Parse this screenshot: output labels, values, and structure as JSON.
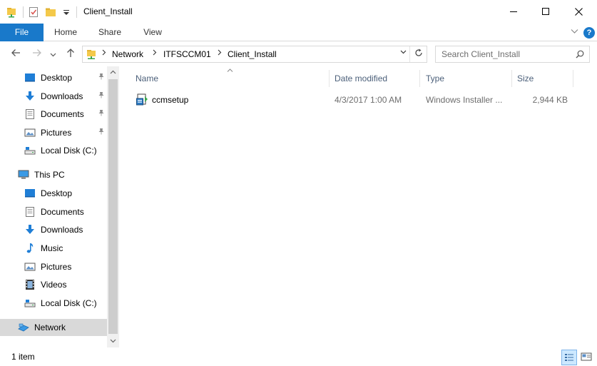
{
  "window": {
    "title": "Client_Install",
    "controls": {
      "minimize_icon": "minimize-icon",
      "maximize_icon": "maximize-icon",
      "close_icon": "close-icon"
    }
  },
  "quick_access_toolbar": {
    "icons": [
      "properties-icon",
      "new-folder-icon",
      "customize-dropdown-icon"
    ]
  },
  "ribbon": {
    "tabs": [
      {
        "label": "File",
        "active": true
      },
      {
        "label": "Home"
      },
      {
        "label": "Share"
      },
      {
        "label": "View"
      }
    ],
    "help_label": "?"
  },
  "address_bar": {
    "breadcrumbs": [
      "Network",
      "ITFSCCM01",
      "Client_Install"
    ]
  },
  "search": {
    "placeholder": "Search Client_Install"
  },
  "nav_pane": {
    "quick_access": [
      {
        "label": "Desktop",
        "icon": "desktop-icon",
        "pinned": true
      },
      {
        "label": "Downloads",
        "icon": "downloads-icon",
        "pinned": true
      },
      {
        "label": "Documents",
        "icon": "documents-icon",
        "pinned": true
      },
      {
        "label": "Pictures",
        "icon": "pictures-icon",
        "pinned": true
      },
      {
        "label": "Local Disk (C:)",
        "icon": "drive-icon",
        "pinned": false
      }
    ],
    "this_pc": {
      "label": "This PC",
      "items": [
        {
          "label": "Desktop",
          "icon": "desktop-icon"
        },
        {
          "label": "Documents",
          "icon": "documents-icon"
        },
        {
          "label": "Downloads",
          "icon": "downloads-icon"
        },
        {
          "label": "Music",
          "icon": "music-icon"
        },
        {
          "label": "Pictures",
          "icon": "pictures-icon"
        },
        {
          "label": "Videos",
          "icon": "videos-icon"
        },
        {
          "label": "Local Disk (C:)",
          "icon": "drive-icon"
        }
      ]
    },
    "network": {
      "label": "Network",
      "icon": "network-icon",
      "selected": true
    }
  },
  "file_list": {
    "columns": {
      "name": "Name",
      "date_modified": "Date modified",
      "type": "Type",
      "size": "Size"
    },
    "rows": [
      {
        "name": "ccmsetup",
        "date_modified": "4/3/2017 1:00 AM",
        "type": "Windows Installer ...",
        "size": "2,944 KB",
        "icon": "installer-package-icon"
      }
    ]
  },
  "status_bar": {
    "item_count": "1 item",
    "views": [
      "details-view-icon",
      "large-icons-view-icon"
    ]
  },
  "colors": {
    "file_tab": "#1979ca",
    "selected_nav": "#d9d9d9",
    "column_header_text": "#4c607a",
    "accent_blue": "#1979ca"
  }
}
